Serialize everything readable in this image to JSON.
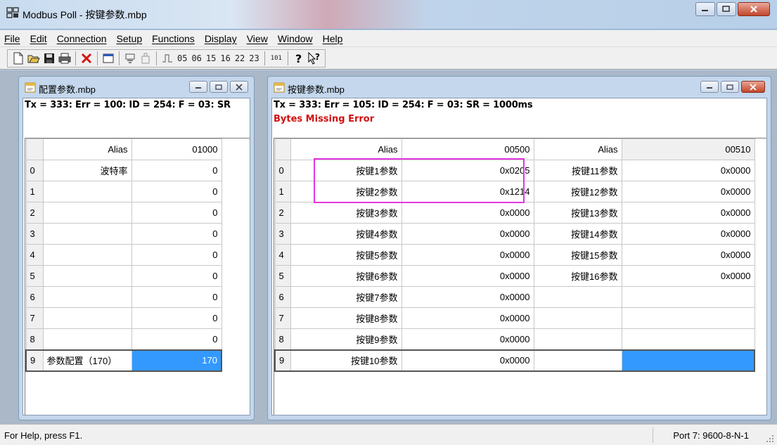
{
  "window": {
    "title": "Modbus Poll - 按键参数.mbp",
    "min_label": "–",
    "max_label": "□",
    "close_label": "x"
  },
  "menu": [
    "File",
    "Edit",
    "Connection",
    "Setup",
    "Functions",
    "Display",
    "View",
    "Window",
    "Help"
  ],
  "toolbar": {
    "items": [
      "new-icon",
      "open-icon",
      "save-icon",
      "print-icon",
      "delete-icon",
      "window-icon",
      "read-icon",
      "write-icon",
      "pulse-icon"
    ],
    "function_codes": [
      "05",
      "06",
      "15",
      "16",
      "22",
      "23"
    ],
    "small_label": "101",
    "help_label": "?",
    "whats_this_label": "?"
  },
  "left_window": {
    "title": "配置参数.mbp",
    "status": "Tx = 333: Err = 100: ID = 254: F = 03: SR",
    "columns": [
      "Alias",
      "01000"
    ],
    "rows": [
      {
        "idx": "0",
        "alias": "波特率",
        "value": "0"
      },
      {
        "idx": "1",
        "alias": "",
        "value": "0"
      },
      {
        "idx": "2",
        "alias": "",
        "value": "0"
      },
      {
        "idx": "3",
        "alias": "",
        "value": "0"
      },
      {
        "idx": "4",
        "alias": "",
        "value": "0"
      },
      {
        "idx": "5",
        "alias": "",
        "value": "0"
      },
      {
        "idx": "6",
        "alias": "",
        "value": "0"
      },
      {
        "idx": "7",
        "alias": "",
        "value": "0"
      },
      {
        "idx": "8",
        "alias": "",
        "value": "0"
      },
      {
        "idx": "9",
        "alias": "参数配置（170）",
        "value": "170"
      }
    ]
  },
  "right_window": {
    "title": "按键参数.mbp",
    "status": "Tx = 333: Err = 105: ID = 254: F = 03: SR = 1000ms",
    "error": "Bytes Missing Error",
    "columns": [
      "Alias",
      "00500",
      "Alias",
      "00510"
    ],
    "rows": [
      {
        "idx": "0",
        "a1": "按键1参数",
        "v1": "0x0205",
        "a2": "按键11参数",
        "v2": "0x0000"
      },
      {
        "idx": "1",
        "a1": "按键2参数",
        "v1": "0x1214",
        "a2": "按键12参数",
        "v2": "0x0000"
      },
      {
        "idx": "2",
        "a1": "按键3参数",
        "v1": "0x0000",
        "a2": "按键13参数",
        "v2": "0x0000"
      },
      {
        "idx": "3",
        "a1": "按键4参数",
        "v1": "0x0000",
        "a2": "按键14参数",
        "v2": "0x0000"
      },
      {
        "idx": "4",
        "a1": "按键5参数",
        "v1": "0x0000",
        "a2": "按键15参数",
        "v2": "0x0000"
      },
      {
        "idx": "5",
        "a1": "按键6参数",
        "v1": "0x0000",
        "a2": "按键16参数",
        "v2": "0x0000"
      },
      {
        "idx": "6",
        "a1": "按键7参数",
        "v1": "0x0000",
        "a2": "",
        "v2": ""
      },
      {
        "idx": "7",
        "a1": "按键8参数",
        "v1": "0x0000",
        "a2": "",
        "v2": ""
      },
      {
        "idx": "8",
        "a1": "按键9参数",
        "v1": "0x0000",
        "a2": "",
        "v2": ""
      },
      {
        "idx": "9",
        "a1": "按键10参数",
        "v1": "0x0000",
        "a2": "",
        "v2": ""
      }
    ]
  },
  "statusbar": {
    "help": "For Help, press F1.",
    "port": "Port 7: 9600-8-N-1"
  },
  "colors": {
    "selection": "#3399ff",
    "highlight_box": "#e335e3",
    "error_text": "#d01010"
  }
}
